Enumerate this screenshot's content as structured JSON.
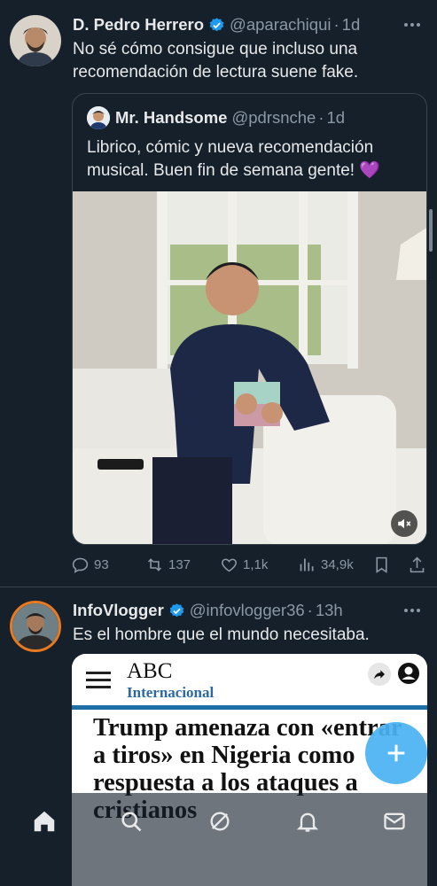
{
  "tweets": [
    {
      "author_name": "D. Pedro Herrero",
      "handle": "@aparachiqui",
      "separator": "·",
      "time": "1d",
      "text": "No sé cómo consigue que incluso una recomendación de lectura suene fake.",
      "quote": {
        "author_name": "Mr. Handsome",
        "handle": "@pdrsnche",
        "separator": "·",
        "time": "1d",
        "text": "Librico, cómic y nueva recomendación musical. Buen fin de semana gente! 💜"
      },
      "stats": {
        "replies": "93",
        "retweets": "137",
        "likes": "1,1k",
        "views": "34,9k"
      }
    },
    {
      "author_name": "InfoVlogger",
      "handle": "@infovlogger36",
      "separator": "·",
      "time": "13h",
      "text": "Es el hombre que el mundo necesitaba.",
      "article": {
        "logo": "ABC",
        "section": "Internacional",
        "headline": "Trump amenaza con «entrar a tiros» en Nigeria como respuesta a los ataques a cristianos"
      }
    }
  ],
  "colors": {
    "background": "#15202b",
    "accent": "#1d9bf0",
    "fab": "#4ab3f4",
    "muted": "#8b98a5"
  },
  "icons": [
    "home-icon",
    "search-icon",
    "grok-icon",
    "bell-icon",
    "mail-icon",
    "plus-icon",
    "verified-icon",
    "mute-icon"
  ]
}
